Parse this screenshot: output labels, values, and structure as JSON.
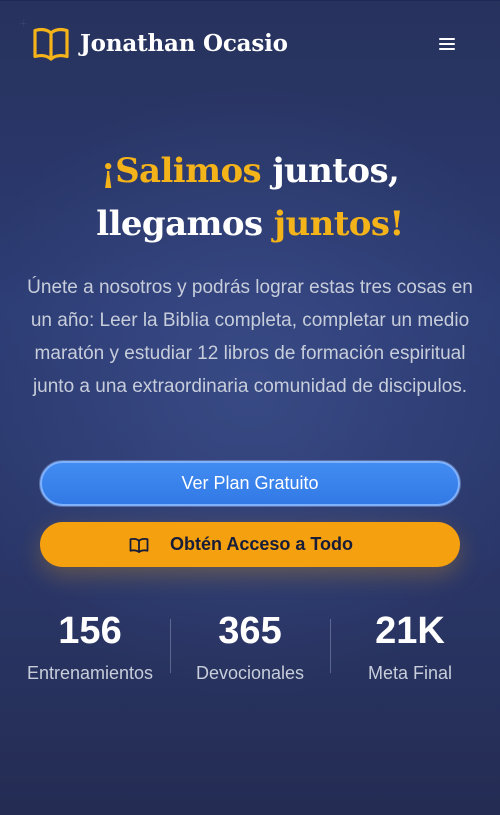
{
  "colors": {
    "accent": "#f5b31a",
    "primary_button": "#3b82f6",
    "secondary_button": "#f5a00f",
    "background": "#172765"
  },
  "header": {
    "brand_name": "Jonathan Ocasio",
    "logo_icon": "open-book-icon",
    "menu_icon": "hamburger-menu-icon"
  },
  "hero": {
    "headline": {
      "line1_gold": "¡Salimos",
      "line1_white": " juntos,",
      "line2_white": "llegamos ",
      "line2_gold": "juntos!"
    },
    "intro": "Únete a nosotros y podrás lograr estas tres cosas en un año: Leer la Biblia completa, completar un medio maratón y estudiar 12 libros de formación espiritual junto a una extraordinaria comunidad de discipulos."
  },
  "actions": {
    "primary_label": "Ver Plan Gratuito",
    "secondary_label": "Obtén Acceso a Todo",
    "secondary_icon": "open-book-icon"
  },
  "stats": [
    {
      "value": "156",
      "label": "Entrenamientos"
    },
    {
      "value": "365",
      "label": "Devocionales"
    },
    {
      "value": "21K",
      "label": "Meta Final"
    }
  ]
}
